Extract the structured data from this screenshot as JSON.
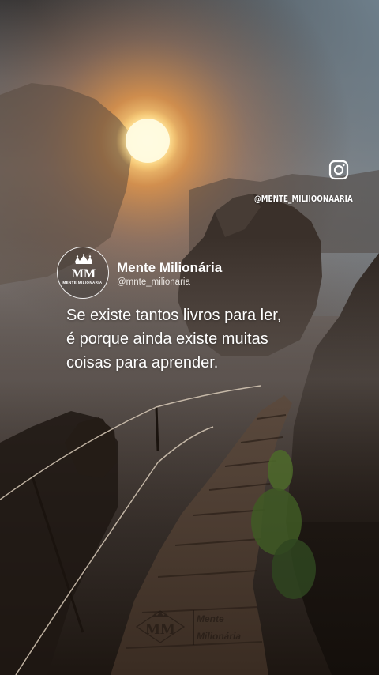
{
  "instagram": {
    "icon": "instagram-icon",
    "handle": "@MENTE_MILIIOONAARIA"
  },
  "post": {
    "author_name": "Mente Milionária",
    "author_handle": "@mnte_milionaria",
    "avatar_monogram": "MM",
    "avatar_caption": "MENTE MILIONÁRIA",
    "quote_lines": [
      "Se existe tantos livros para ler,",
      "é porque ainda existe muitas",
      "coisas para aprender."
    ]
  },
  "watermark": {
    "monogram": "MM",
    "line1": "Mente",
    "line2": "Milionária"
  },
  "colors": {
    "text": "#ffffff",
    "sun": "#fff3c4",
    "sky_warm": "#c98a5a",
    "sky_cool": "#7f8a92"
  }
}
